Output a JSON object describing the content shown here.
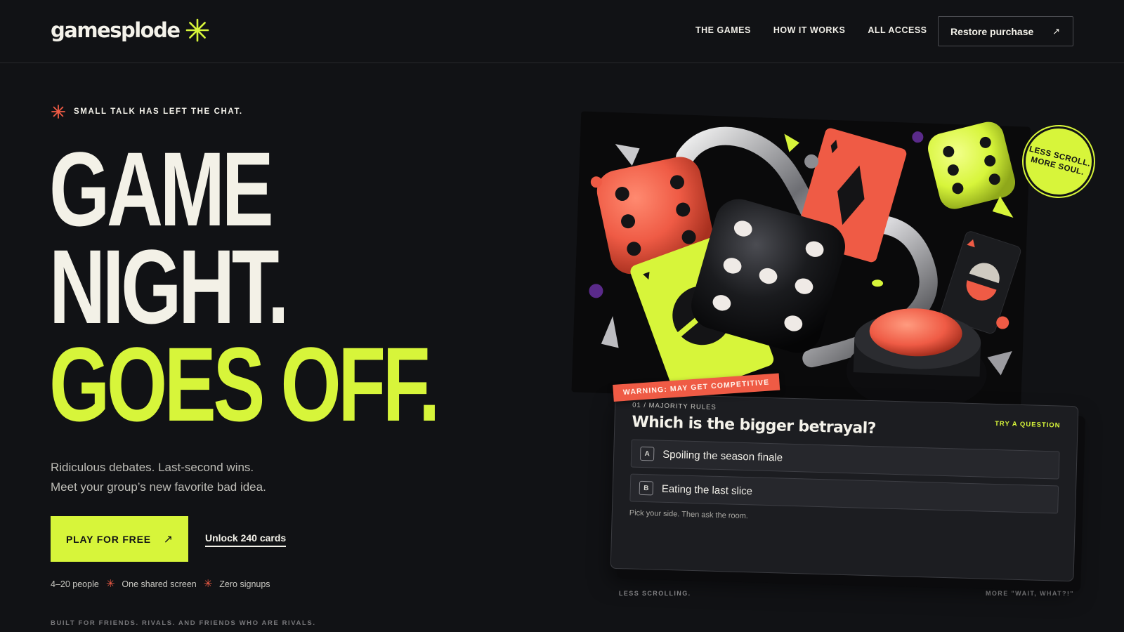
{
  "header": {
    "logo": "gamesplode",
    "nav": [
      "THE GAMES",
      "HOW IT WORKS",
      "ALL ACCESS"
    ],
    "restore_label": "Restore purchase",
    "restore_icon": "↗"
  },
  "hero": {
    "eyebrow": "SMALL TALK HAS LEFT THE CHAT.",
    "headline": {
      "line1": "GAME",
      "line2": "NIGHT",
      "line2_dot": ".",
      "line3": "GOES OFF",
      "line3_dot": "."
    },
    "subcopy_line1": "Ridiculous debates. Last-second wins.",
    "subcopy_line2": "Meet your group’s new favorite bad idea.",
    "cta_primary": "PLAY FOR FREE",
    "cta_primary_icon": "↗",
    "cta_secondary": "Unlock 240 cards",
    "facts": [
      "4–20 people",
      "One shared screen",
      "Zero signups"
    ],
    "fact_separator": "✳",
    "footnote": "BUILT FOR FRIENDS. RIVALS. AND FRIENDS WHO ARE RIVALS."
  },
  "art": {
    "sticker": "LESS SCROLL.\nMORE SOUL.",
    "warning": "WARNING: MAY GET COMPETITIVE"
  },
  "question_card": {
    "category": "01 / MAJORITY RULES",
    "try_label": "TRY A QUESTION",
    "question": "Which is the bigger betrayal?",
    "options": [
      {
        "key": "A",
        "text": "Spoiling the season finale"
      },
      {
        "key": "B",
        "text": "Eating the last slice"
      }
    ],
    "hint": "Pick your side. Then ask the room."
  },
  "captions": {
    "left": "LESS SCROLLING.",
    "right": "MORE \"WAIT, WHAT?!\""
  },
  "colors": {
    "background": "#111215",
    "accent_lime": "#d7f53a",
    "accent_coral": "#ef5b45",
    "text": "#f1efe8"
  },
  "icons": [
    "sparkle-icon",
    "asterisk-icon",
    "arrow-up-right-icon"
  ]
}
